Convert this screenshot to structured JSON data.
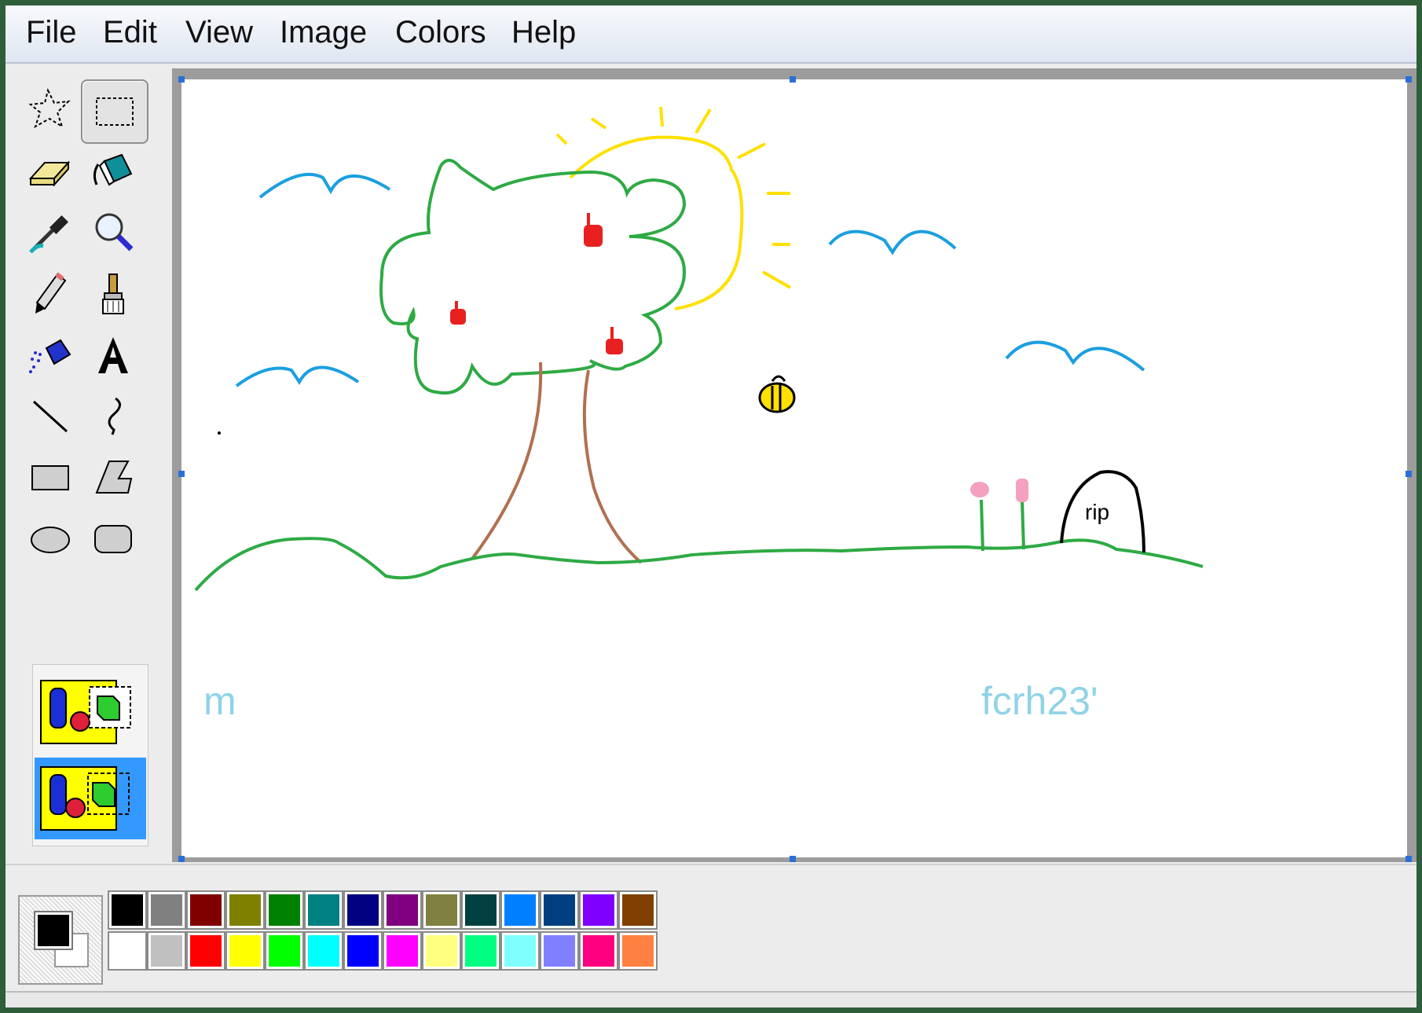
{
  "menu": {
    "file": "File",
    "edit": "Edit",
    "view": "View",
    "image": "Image",
    "colors": "Colors",
    "help": "Help"
  },
  "tools": [
    {
      "name": "free-form-select",
      "icon": "free-select-icon"
    },
    {
      "name": "select",
      "icon": "rect-select-icon",
      "selected": true
    },
    {
      "name": "eraser",
      "icon": "eraser-icon"
    },
    {
      "name": "fill",
      "icon": "paint-bucket-icon"
    },
    {
      "name": "pick-color",
      "icon": "eyedropper-icon"
    },
    {
      "name": "magnifier",
      "icon": "magnifier-icon"
    },
    {
      "name": "pencil",
      "icon": "pencil-icon"
    },
    {
      "name": "brush",
      "icon": "brush-icon"
    },
    {
      "name": "airbrush",
      "icon": "airbrush-icon"
    },
    {
      "name": "text",
      "icon": "text-icon"
    },
    {
      "name": "line",
      "icon": "line-icon"
    },
    {
      "name": "curve",
      "icon": "curve-icon"
    },
    {
      "name": "rectangle",
      "icon": "rectangle-icon"
    },
    {
      "name": "polygon",
      "icon": "polygon-icon"
    },
    {
      "name": "ellipse",
      "icon": "ellipse-icon"
    },
    {
      "name": "rounded-rectangle",
      "icon": "rounded-rectangle-icon"
    }
  ],
  "tool_options": {
    "selected": "transparent-selection"
  },
  "drawing": {
    "signature_left": "m",
    "signature_right": "fcrh23'",
    "tombstone_text": "rip"
  },
  "colors": {
    "foreground": "#000000",
    "background": "#ffffff",
    "palette_row1": [
      "#000000",
      "#808080",
      "#800000",
      "#808000",
      "#008000",
      "#008080",
      "#000080",
      "#800080",
      "#808040",
      "#004040",
      "#0080ff",
      "#004080",
      "#8000ff",
      "#804000"
    ],
    "palette_row2": [
      "#ffffff",
      "#c0c0c0",
      "#ff0000",
      "#ffff00",
      "#00ff00",
      "#00ffff",
      "#0000ff",
      "#ff00ff",
      "#ffff80",
      "#00ff80",
      "#80ffff",
      "#8080ff",
      "#ff0080",
      "#ff8040"
    ]
  }
}
